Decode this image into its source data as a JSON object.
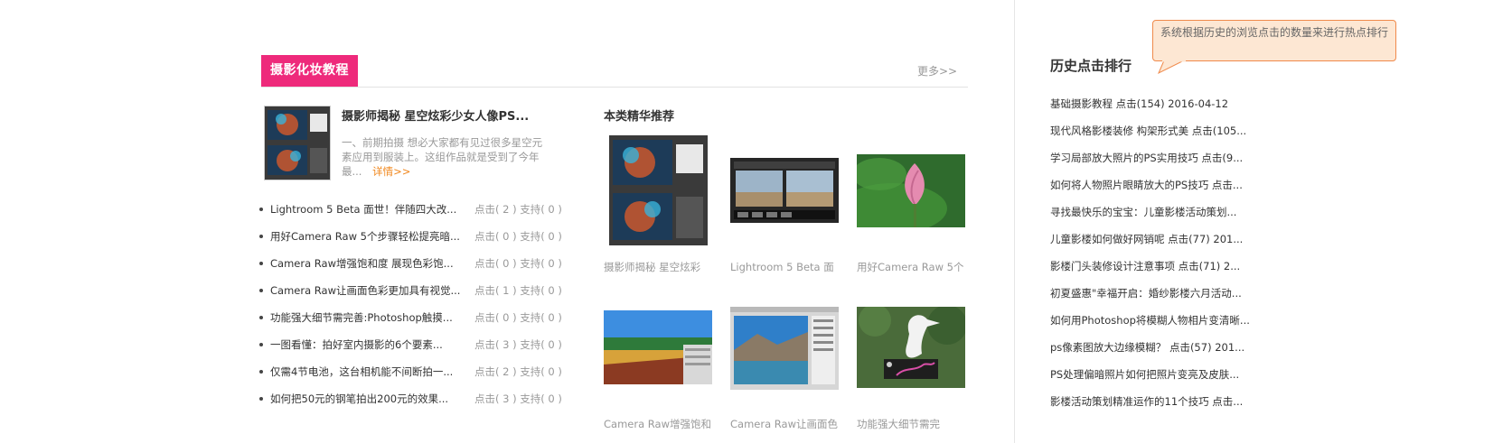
{
  "section": {
    "title": "摄影化妆教程",
    "more_label": "更多>>"
  },
  "featured": {
    "title": "摄影师揭秘 星空炫彩少女人像PS...",
    "desc_line1": "一、前期拍摄 想必大家都有见过很多星空元",
    "desc_line2": "素应用到服装上。这组作品就是受到了今年",
    "desc_line3": "最...",
    "detail_label": "详情>>"
  },
  "articles": [
    {
      "title": "Lightroom 5 Beta 面世！伴随四大改...",
      "stats": "点击( 2 ) 支持( 0 )"
    },
    {
      "title": "用好Camera Raw 5个步骤轻松提亮暗...",
      "stats": "点击( 0 ) 支持( 0 )"
    },
    {
      "title": "Camera Raw增强饱和度 展现色彩饱...",
      "stats": "点击( 0 ) 支持( 0 )"
    },
    {
      "title": "Camera Raw让画面色彩更加具有视觉...",
      "stats": "点击( 1 ) 支持( 0 )"
    },
    {
      "title": "功能强大细节需完善:Photoshop触摸...",
      "stats": "点击( 0 ) 支持( 0 )"
    },
    {
      "title": "一图看懂：拍好室内摄影的6个要素...",
      "stats": "点击( 3 ) 支持( 0 )"
    },
    {
      "title": "仅需4节电池，这台相机能不间断拍一...",
      "stats": "点击( 2 ) 支持( 0 )"
    },
    {
      "title": "如何把50元的钢笔拍出200元的效果...",
      "stats": "点击( 3 ) 支持( 0 )"
    }
  ],
  "recommend": {
    "title": "本类精华推荐",
    "cards": [
      {
        "caption": "摄影师揭秘 星空炫彩"
      },
      {
        "caption": "Lightroom 5 Beta 面"
      },
      {
        "caption": "用好Camera Raw 5个"
      },
      {
        "caption": "Camera Raw增强饱和"
      },
      {
        "caption": "Camera Raw让画面色"
      },
      {
        "caption": "功能强大细节需完"
      }
    ]
  },
  "ranking": {
    "title": "历史点击排行",
    "tooltip": "系统根据历史的浏览点击的数量来进行热点排行",
    "items": [
      "基础摄影教程  点击(154)  2016-04-12",
      "现代风格影楼装修 构架形式美  点击(105...",
      "学习局部放大照片的PS实用技巧  点击(9...",
      "如何将人物照片眼睛放大的PS技巧  点击...",
      "寻找最快乐的宝宝：儿童影楼活动策划...",
      "儿童影楼如何做好网销呢  点击(77)  201...",
      "影楼门头装修设计注意事项  点击(71)  2...",
      "初夏盛惠\"幸福开启：婚纱影楼六月活动...",
      "如何用Photoshop将模糊人物相片变清晰...",
      "ps像素图放大边缘模糊？  点击(57)  201...",
      "PS处理偏暗照片如何把照片变亮及皮肤...",
      "影楼活动策划精准运作的11个技巧  点击..."
    ]
  },
  "colors": {
    "accent_pink": "#ee2a7b",
    "detail_orange": "#f08519",
    "tooltip_bg": "#fde7d3",
    "tooltip_border": "#f08a4b"
  }
}
